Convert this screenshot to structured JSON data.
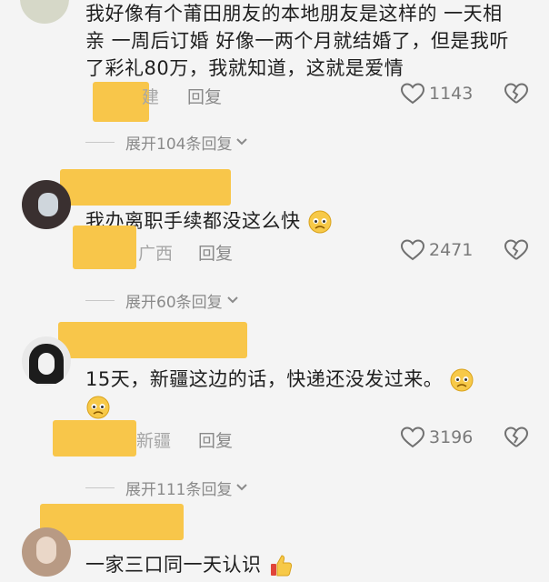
{
  "comments": [
    {
      "text": "我好像有个莆田朋友的本地朋友是这样的 一天相亲 一周后订婚 好像一两个月就结婚了，但是我听了彩礼80万，我就知道，这就是爱情",
      "location": "建",
      "reply": "回复",
      "likes": "1143",
      "expand": "展开104条回复"
    },
    {
      "text": "我办离职手续都没这么快",
      "location": "广西",
      "reply": "回复",
      "likes": "2471",
      "expand": "展开60条回复"
    },
    {
      "text": "15天，新疆这边的话，快递还没发过来。",
      "location": "新疆",
      "reply": "回复",
      "likes": "3196",
      "expand": "展开111条回复"
    },
    {
      "text": "一家三口同一天认识"
    }
  ],
  "colors": {
    "mask": "#f8c64a",
    "background": "#f4f4f4"
  },
  "icons": [
    "heart-icon",
    "broken-heart-icon",
    "chevron-down-icon",
    "worried-emoji",
    "thumbs-up-emoji"
  ]
}
